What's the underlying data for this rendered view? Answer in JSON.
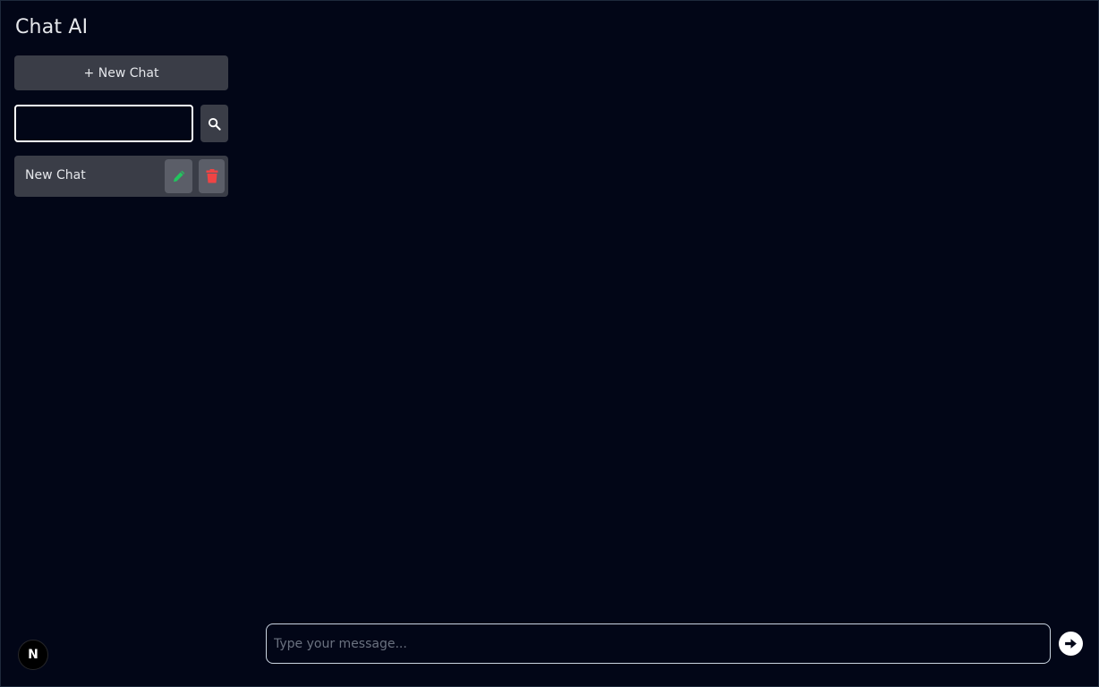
{
  "sidebar": {
    "title": "Chat AI",
    "new_chat_label": "+ New Chat",
    "search": {
      "value": "",
      "placeholder": "",
      "button_icon": "search-icon"
    },
    "chats": [
      {
        "title": "New Chat",
        "edit_icon": "pencil-icon",
        "delete_icon": "trash-icon"
      }
    ]
  },
  "user": {
    "avatar_initial": "N"
  },
  "composer": {
    "placeholder": "Type your message...",
    "value": "",
    "send_icon": "arrow-right-circle-icon"
  },
  "colors": {
    "background": "#020617",
    "panel": "#3a3d47",
    "icon_button": "#5b5e68",
    "edit_icon": "#22c55e",
    "delete_icon": "#ef4444",
    "text": "#e5e7eb"
  }
}
